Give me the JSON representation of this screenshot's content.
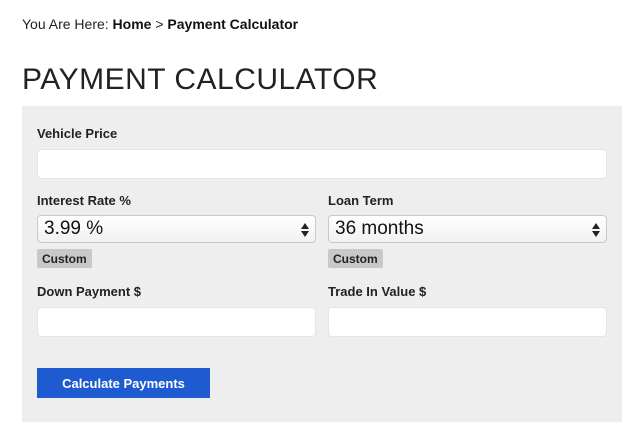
{
  "breadcrumb": {
    "prefix": "You Are Here:",
    "home": "Home",
    "separator": ">",
    "current": "Payment Calculator"
  },
  "page": {
    "title": "PAYMENT CALCULATOR"
  },
  "form": {
    "vehicle_price": {
      "label": "Vehicle Price",
      "value": ""
    },
    "interest_rate": {
      "label": "Interest Rate %",
      "selected": "3.99 %",
      "custom_label": "Custom"
    },
    "loan_term": {
      "label": "Loan Term",
      "selected": "36 months",
      "custom_label": "Custom"
    },
    "down_payment": {
      "label": "Down Payment $",
      "value": ""
    },
    "trade_in": {
      "label": "Trade In Value $",
      "value": ""
    },
    "submit_label": "Calculate Payments"
  },
  "colors": {
    "accent": "#1f5bd0",
    "panel_bg": "#eeeeee"
  }
}
